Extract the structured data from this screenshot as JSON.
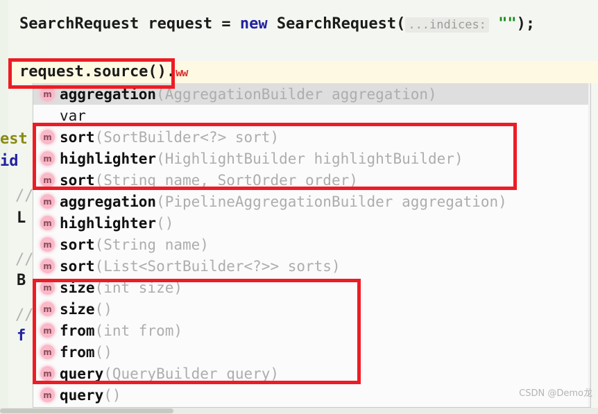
{
  "editor": {
    "line1": {
      "prefix": "SearchRequest request = ",
      "keyword": "new",
      "mid": " SearchRequest(",
      "param_hint": "...indices:",
      "string_literal": "\"\"",
      "suffix": ");"
    },
    "line2": {
      "text": "request.source()",
      "dot": ".",
      "error_squiggle": "ww"
    },
    "background_code": [
      {
        "text": "est",
        "color_name": "olive"
      },
      {
        "text": "id",
        "color_name": "blue"
      },
      {
        "text": "//",
        "color_name": "comment"
      },
      {
        "text": "L",
        "color_name": "dark"
      },
      {
        "text": "//",
        "color_name": "comment"
      },
      {
        "text": "B",
        "color_name": "dark"
      },
      {
        "text": "//",
        "color_name": "comment"
      },
      {
        "text": "f",
        "color_name": "blue"
      }
    ]
  },
  "completion_popup": {
    "icon_label": "m",
    "rows": [
      {
        "icon": "method-icon",
        "name": "aggregation",
        "signature": "(AggregationBuilder aggregation)",
        "selected": true,
        "plain": false
      },
      {
        "icon": "",
        "name": "var",
        "signature": "",
        "selected": false,
        "plain": true
      },
      {
        "icon": "method-icon",
        "name": "sort",
        "signature": "(SortBuilder<?> sort)",
        "selected": false,
        "plain": false
      },
      {
        "icon": "method-icon",
        "name": "highlighter",
        "signature": "(HighlightBuilder highlightBuilder)",
        "selected": false,
        "plain": false
      },
      {
        "icon": "method-icon",
        "name": "sort",
        "signature": "(String name, SortOrder order)",
        "selected": false,
        "plain": false
      },
      {
        "icon": "method-icon",
        "name": "aggregation",
        "signature": "(PipelineAggregationBuilder aggregation)",
        "selected": false,
        "plain": false
      },
      {
        "icon": "method-icon",
        "name": "highlighter",
        "signature": "()",
        "selected": false,
        "plain": false
      },
      {
        "icon": "method-icon",
        "name": "sort",
        "signature": "(String name)",
        "selected": false,
        "plain": false
      },
      {
        "icon": "method-icon",
        "name": "sort",
        "signature": "(List<SortBuilder<?>> sorts)",
        "selected": false,
        "plain": false
      },
      {
        "icon": "method-icon",
        "name": "size",
        "signature": "(int size)",
        "selected": false,
        "plain": false
      },
      {
        "icon": "method-icon",
        "name": "size",
        "signature": "()",
        "selected": false,
        "plain": false
      },
      {
        "icon": "method-icon",
        "name": "from",
        "signature": "(int from)",
        "selected": false,
        "plain": false
      },
      {
        "icon": "method-icon",
        "name": "from",
        "signature": "()",
        "selected": false,
        "plain": false
      },
      {
        "icon": "method-icon",
        "name": "query",
        "signature": "(QueryBuilder query)",
        "selected": false,
        "plain": false
      },
      {
        "icon": "method-icon",
        "name": "query",
        "signature": "()",
        "selected": false,
        "plain": false
      }
    ]
  },
  "annotations": {
    "highlight_color": "#ed1c24",
    "boxes": [
      {
        "id": "source-call",
        "targets": "request.source()"
      },
      {
        "id": "sort-group",
        "targets": "sort / highlighter / sort"
      },
      {
        "id": "size-from-query",
        "targets": "size / size / from / from / query"
      }
    ]
  },
  "watermark": {
    "text": "CSDN @Demo龙"
  },
  "colors": {
    "keyword": "#2222a0",
    "string": "#1c8b1c",
    "signature_gray": "#adadad",
    "method_icon_bg": "#f9b9c8",
    "selected_row_bg": "#dedede",
    "current_line_bg": "#fdf9e3",
    "editor_bg": "#f4f7f1"
  }
}
